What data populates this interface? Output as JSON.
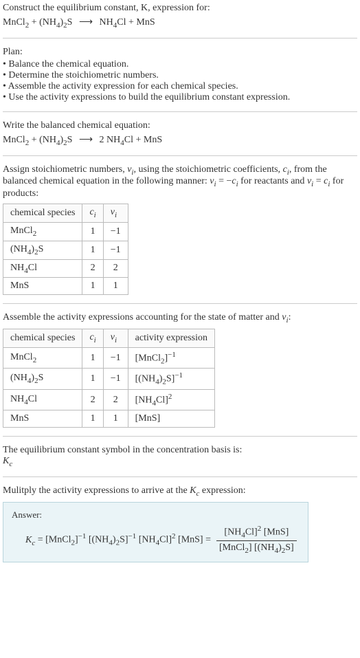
{
  "header": {
    "prompt_line1": "Construct the equilibrium constant, K, expression for:",
    "reaction_unbalanced": "MnCl₂ + (NH₄)₂S ⟶ NH₄Cl + MnS"
  },
  "plan": {
    "title": "Plan:",
    "items": [
      "Balance the chemical equation.",
      "Determine the stoichiometric numbers.",
      "Assemble the activity expression for each chemical species.",
      "Use the activity expressions to build the equilibrium constant expression."
    ]
  },
  "balanced": {
    "prompt": "Write the balanced chemical equation:",
    "reaction_balanced": "MnCl₂ + (NH₄)₂S ⟶ 2 NH₄Cl + MnS"
  },
  "assign": {
    "text": "Assign stoichiometric numbers, νᵢ, using the stoichiometric coefficients, cᵢ, from the balanced chemical equation in the following manner: νᵢ = −cᵢ for reactants and νᵢ = cᵢ for products:"
  },
  "table1": {
    "headers": [
      "chemical species",
      "cᵢ",
      "νᵢ"
    ],
    "rows": [
      [
        "MnCl₂",
        "1",
        "−1"
      ],
      [
        "(NH₄)₂S",
        "1",
        "−1"
      ],
      [
        "NH₄Cl",
        "2",
        "2"
      ],
      [
        "MnS",
        "1",
        "1"
      ]
    ]
  },
  "assemble": {
    "text": "Assemble the activity expressions accounting for the state of matter and νᵢ:"
  },
  "table2": {
    "headers": [
      "chemical species",
      "cᵢ",
      "νᵢ",
      "activity expression"
    ],
    "rows": [
      [
        "MnCl₂",
        "1",
        "−1",
        "[MnCl₂]⁻¹"
      ],
      [
        "(NH₄)₂S",
        "1",
        "−1",
        "[(NH₄)₂S]⁻¹"
      ],
      [
        "NH₄Cl",
        "2",
        "2",
        "[NH₄Cl]²"
      ],
      [
        "MnS",
        "1",
        "1",
        "[MnS]"
      ]
    ]
  },
  "symbol": {
    "text": "The equilibrium constant symbol in the concentration basis is:",
    "kc": "K_c"
  },
  "multiply": {
    "text": "Mulitply the activity expressions to arrive at the K_c expression:"
  },
  "answer": {
    "label": "Answer:",
    "lhs": "K_c = [MnCl₂]⁻¹ [(NH₄)₂S]⁻¹ [NH₄Cl]² [MnS] =",
    "numerator": "[NH₄Cl]² [MnS]",
    "denominator": "[MnCl₂] [(NH₄)₂S]"
  }
}
